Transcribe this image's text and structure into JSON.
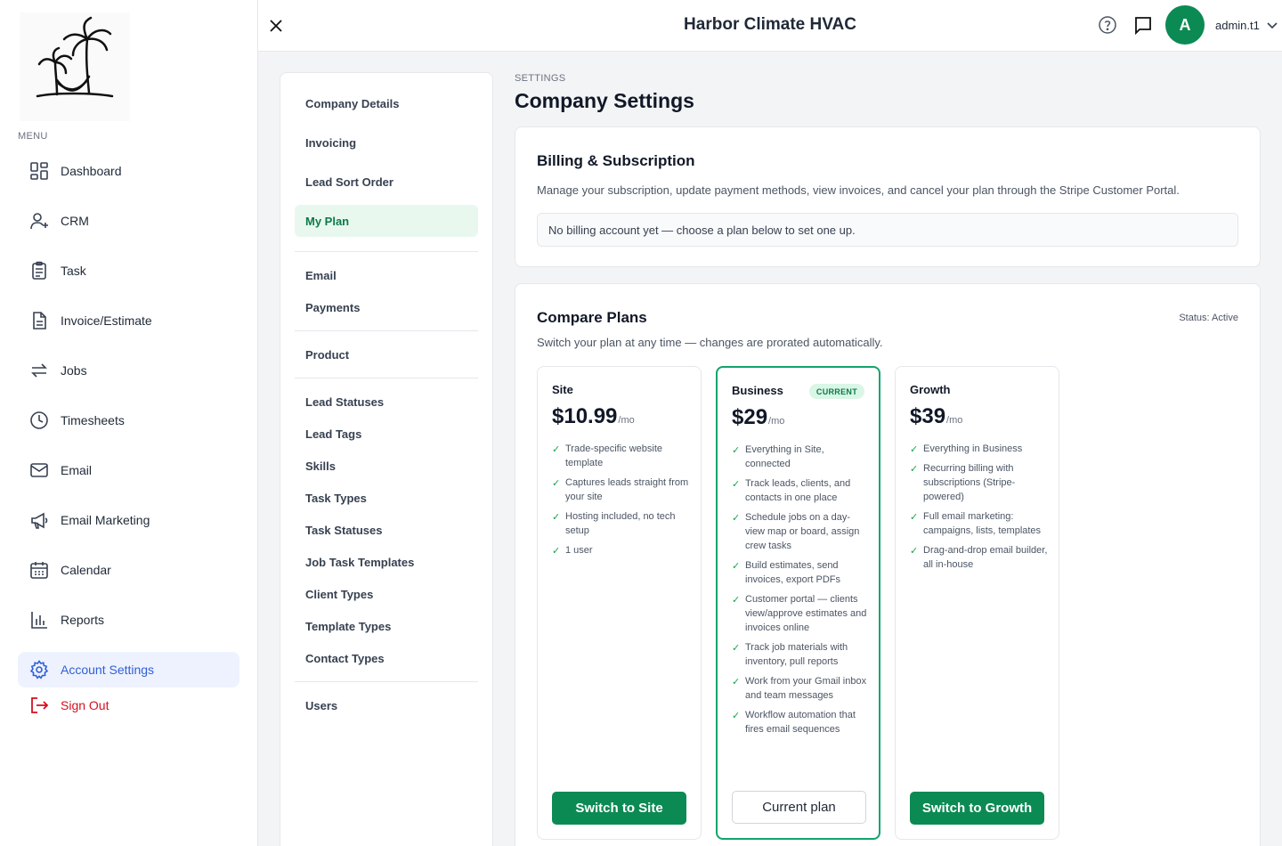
{
  "app": {
    "title": "Harbor Climate HVAC"
  },
  "header": {
    "avatar_letter": "A",
    "username": "admin.t1"
  },
  "sidebar": {
    "menu_label": "MENU",
    "items": [
      {
        "label": "Dashboard",
        "icon": "dashboard-icon"
      },
      {
        "label": "CRM",
        "icon": "user-plus-icon"
      },
      {
        "label": "Task",
        "icon": "clipboard-icon"
      },
      {
        "label": "Invoice/Estimate",
        "icon": "document-icon"
      },
      {
        "label": "Jobs",
        "icon": "swap-arrows-icon"
      },
      {
        "label": "Timesheets",
        "icon": "clock-icon"
      },
      {
        "label": "Email",
        "icon": "mail-icon"
      },
      {
        "label": "Email Marketing",
        "icon": "megaphone-icon"
      },
      {
        "label": "Calendar",
        "icon": "calendar-icon"
      },
      {
        "label": "Reports",
        "icon": "bar-chart-icon"
      },
      {
        "label": "Account Settings",
        "icon": "gear-icon",
        "active": true
      }
    ],
    "signout": "Sign Out"
  },
  "settings_nav": {
    "items": [
      "Company Details",
      "Invoicing",
      "Lead Sort Order",
      "My Plan",
      "Email",
      "Payments",
      "Product",
      "Lead Statuses",
      "Lead Tags",
      "Skills",
      "Task Types",
      "Task Statuses",
      "Job Task Templates",
      "Client Types",
      "Template Types",
      "Contact Types",
      "Users"
    ],
    "active": "My Plan"
  },
  "page": {
    "breadcrumb": "SETTINGS",
    "title": "Company Settings"
  },
  "billing": {
    "title": "Billing & Subscription",
    "description": "Manage your subscription, update payment methods, view invoices, and cancel your plan through the Stripe Customer Portal.",
    "note": "No billing account yet — choose a plan below to set one up."
  },
  "compare": {
    "title": "Compare Plans",
    "status": "Status: Active",
    "description": "Switch your plan at any time — changes are prorated automatically.",
    "plans": [
      {
        "name": "Site",
        "price": "$10.99",
        "period": "/mo",
        "features": [
          "Trade-specific website template",
          "Captures leads straight from your site",
          "Hosting included, no tech setup",
          "1 user"
        ],
        "button": "Switch to Site"
      },
      {
        "name": "Business",
        "price": "$29",
        "period": "/mo",
        "badge": "CURRENT",
        "features": [
          "Everything in Site, connected",
          "Track leads, clients, and contacts in one place",
          "Schedule jobs on a day-view map or board, assign crew tasks",
          "Build estimates, send invoices, export PDFs",
          "Customer portal — clients view/approve estimates and invoices online",
          "Track job materials with inventory, pull reports",
          "Work from your Gmail inbox and team messages",
          "Workflow automation that fires email sequences"
        ],
        "button": "Current plan"
      },
      {
        "name": "Growth",
        "price": "$39",
        "period": "/mo",
        "features": [
          "Everything in Business",
          "Recurring billing with subscriptions (Stripe-powered)",
          "Full email marketing: campaigns, lists, templates",
          "Drag-and-drop email builder, all in-house"
        ],
        "button": "Switch to Growth"
      }
    ]
  },
  "colors": {
    "brand_green": "#0c8a53",
    "active_blue": "#2f5fd6",
    "signout_red": "#d50f1f"
  }
}
